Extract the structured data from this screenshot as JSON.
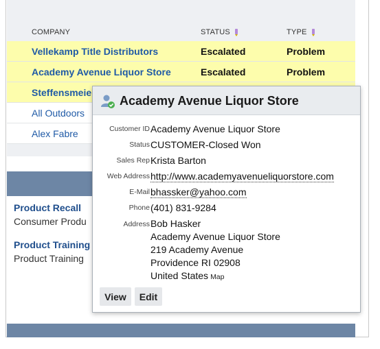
{
  "table": {
    "headers": {
      "company": "COMPANY",
      "status": "STATUS",
      "type": "TYPE"
    },
    "rows": [
      {
        "company": "Vellekamp Title Distributors",
        "status": "Escalated",
        "type": "Problem"
      },
      {
        "company": "Academy Avenue Liquor Store",
        "status": "Escalated",
        "type": "Problem"
      },
      {
        "company": "Steffensmeie",
        "status": "",
        "type": ""
      },
      {
        "company": "All Outdoors",
        "status": "",
        "type": ""
      },
      {
        "company": "Alex Fabre",
        "status": "",
        "type": ""
      }
    ]
  },
  "sections": [
    {
      "title": "Product Recall",
      "sub": "Consumer Produ"
    },
    {
      "title": "Product Training",
      "sub": "Product Training"
    }
  ],
  "popup": {
    "title": "Academy Avenue Liquor Store",
    "icon": "customer-check-icon",
    "fields": {
      "customer_id_label": "Customer ID",
      "customer_id": "Academy Avenue Liquor Store",
      "status_label": "Status",
      "status": "CUSTOMER-Closed Won",
      "sales_rep_label": "Sales Rep",
      "sales_rep": "Krista Barton",
      "web_label": "Web Address",
      "web": "http://www.academyavenueliquorstore.com",
      "email_label": "E-Mail",
      "email": "bhassker@yahoo.com",
      "phone_label": "Phone",
      "phone": "(401) 831-9284",
      "address_label": "Address",
      "address_lines": [
        "Bob Hasker",
        "Academy Avenue Liquor Store",
        "219 Academy Avenue",
        "Providence RI 02908",
        "United States"
      ],
      "map_link": "Map"
    },
    "buttons": {
      "view": "View",
      "edit": "Edit"
    }
  },
  "colors": {
    "highlight_row": "#fdfdac",
    "link_blue": "#1f5aa6",
    "section_bar": "#6d86a5",
    "badge_green": "#4caf50"
  }
}
